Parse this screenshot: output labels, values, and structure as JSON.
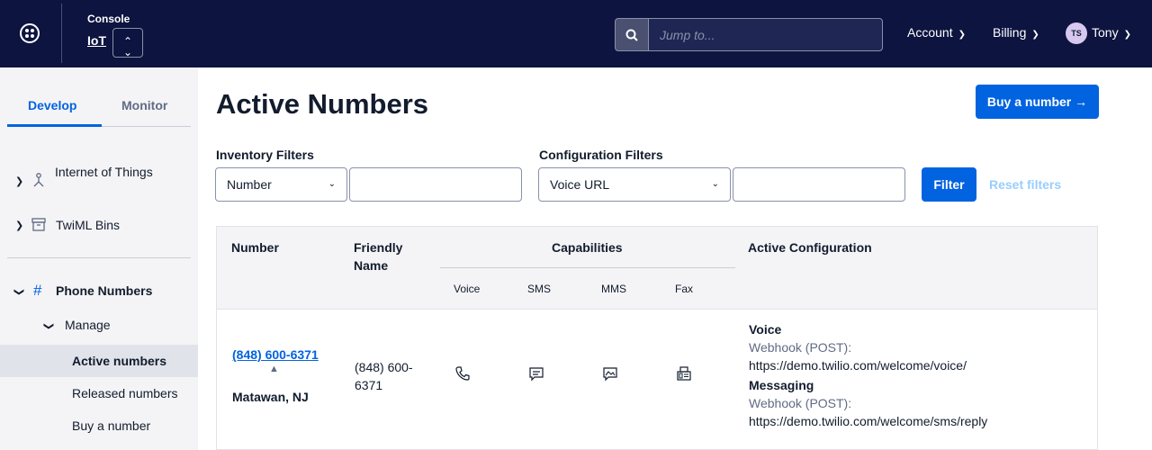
{
  "header": {
    "console_label": "Console",
    "product_label": "IoT",
    "search_placeholder": "Jump to...",
    "account_label": "Account",
    "billing_label": "Billing",
    "user_initials": "TS",
    "user_name": "Tony"
  },
  "sidebar": {
    "tabs": [
      {
        "label": "Develop",
        "active": true
      },
      {
        "label": "Monitor",
        "active": false
      }
    ],
    "items": [
      {
        "label": "Internet of Things",
        "icon": "iot-icon"
      },
      {
        "label": "TwiML Bins",
        "icon": "archive-icon"
      },
      {
        "label": "Phone Numbers",
        "icon": "hash-icon"
      },
      {
        "label": "Manage"
      },
      {
        "label": "Active numbers",
        "active": true
      },
      {
        "label": "Released numbers"
      },
      {
        "label": "Buy a number"
      }
    ]
  },
  "main": {
    "title": "Active Numbers",
    "buy_button": "Buy a number →",
    "inventory_filters_label": "Inventory Filters",
    "inventory_select": "Number",
    "config_filters_label": "Configuration Filters",
    "config_select": "Voice URL",
    "filter_button": "Filter",
    "reset_link": "Reset filters"
  },
  "table": {
    "headers": {
      "number": "Number",
      "friendly_name": "Friendly Name",
      "capabilities": "Capabilities",
      "active_configuration": "Active Configuration"
    },
    "capability_columns": [
      "Voice",
      "SMS",
      "MMS",
      "Fax"
    ],
    "rows": [
      {
        "number": "(848) 600-6371",
        "location": "Matawan, NJ",
        "friendly_name": "(848) 600-6371",
        "capabilities": [
          "phone-icon",
          "sms-icon",
          "mms-icon",
          "fax-icon"
        ],
        "voice_label": "Voice",
        "voice_method": "Webhook (POST):",
        "voice_url": "https://demo.twilio.com/welcome/voice/",
        "messaging_label": "Messaging",
        "messaging_method": "Webhook (POST):",
        "messaging_url": "https://demo.twilio.com/welcome/sms/reply"
      }
    ]
  },
  "colors": {
    "header_bg": "#0d1440",
    "primary": "#0263e0",
    "sidebar_bg": "#f4f4f6",
    "reset_link": "#99cdff"
  }
}
